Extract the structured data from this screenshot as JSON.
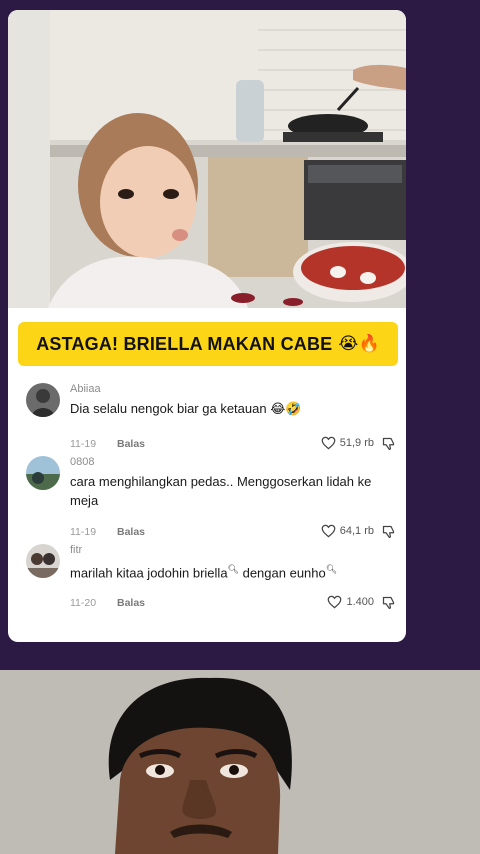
{
  "headline": {
    "title": "ASTAGA! BRIELLA MAKAN CABE",
    "emoji": "😭🔥"
  },
  "comments": [
    {
      "user": "Abiiaa",
      "text": "Dia selalu nengok biar ga ketauan 😂🤣",
      "date": "11-19",
      "reply": "Balas",
      "likes": "51,9 rb"
    },
    {
      "user": "0808",
      "text": "cara menghilangkan pedas.. Menggoserkan lidah ke meja",
      "date": "11-19",
      "reply": "Balas",
      "likes": "64,1 rb"
    },
    {
      "user": "fitr",
      "text_a": "marilah kitaa jodohin ",
      "text_b": "briella",
      "text_c": " dengan ",
      "text_d": "eunho",
      "date": "11-20",
      "reply": "Balas",
      "likes": "1.400"
    }
  ],
  "icons": {
    "like": "heart-outline-icon",
    "dislike": "thumbs-down-icon",
    "search": "search-magnifier-icon"
  },
  "colors": {
    "background": "#2c1a45",
    "card": "#ffffff",
    "headline_bg": "#fcd616"
  }
}
